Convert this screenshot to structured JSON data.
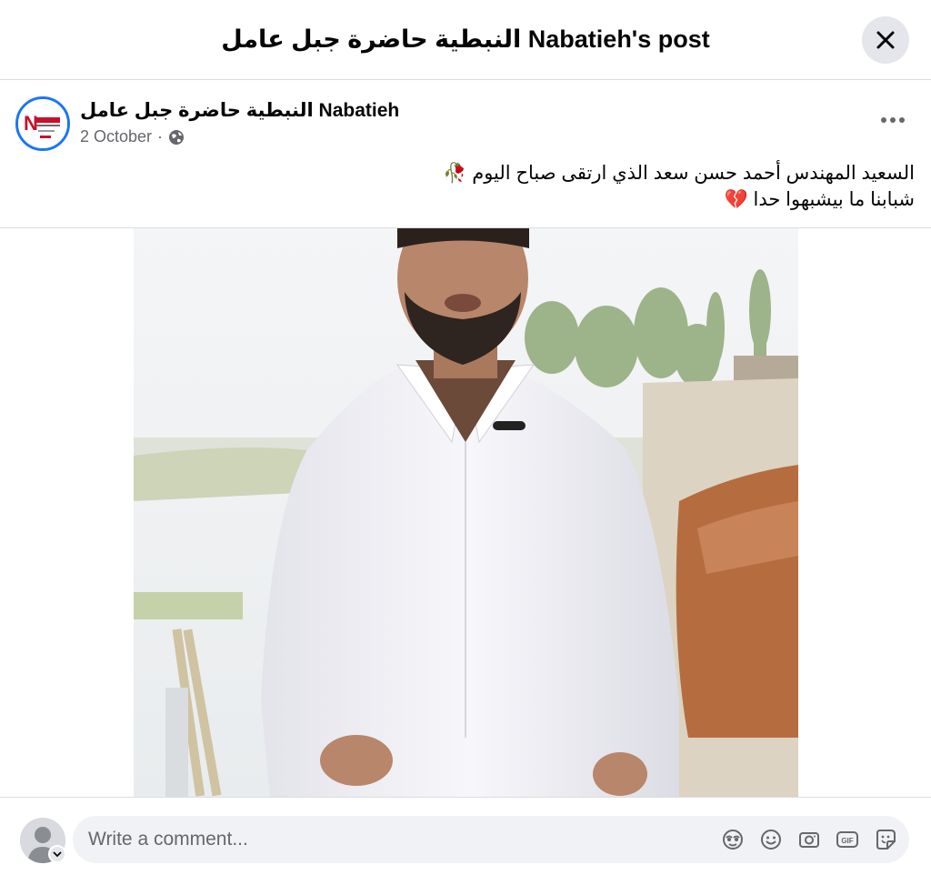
{
  "modal": {
    "title": "النبطية حاضرة جبل عامل Nabatieh's post"
  },
  "post": {
    "author": "النبطية حاضرة جبل عامل Nabatieh",
    "date": "2 October",
    "separator": "·",
    "privacy_icon": "globe-icon",
    "text_line1": "السعيد المهندس أحمد حسن سعد الذي ارتقى صباح اليوم 🥀",
    "text_line2": "شبابنا ما بيشبهوا حدا 💔"
  },
  "comment": {
    "placeholder": "Write a comment...",
    "tools": [
      "avatar-sticker-icon",
      "emoji-icon",
      "camera-icon",
      "gif-icon",
      "sticker-icon"
    ]
  },
  "colors": {
    "accent": "#1877f2",
    "secondary_text": "#65676b",
    "input_bg": "#f0f2f5"
  }
}
